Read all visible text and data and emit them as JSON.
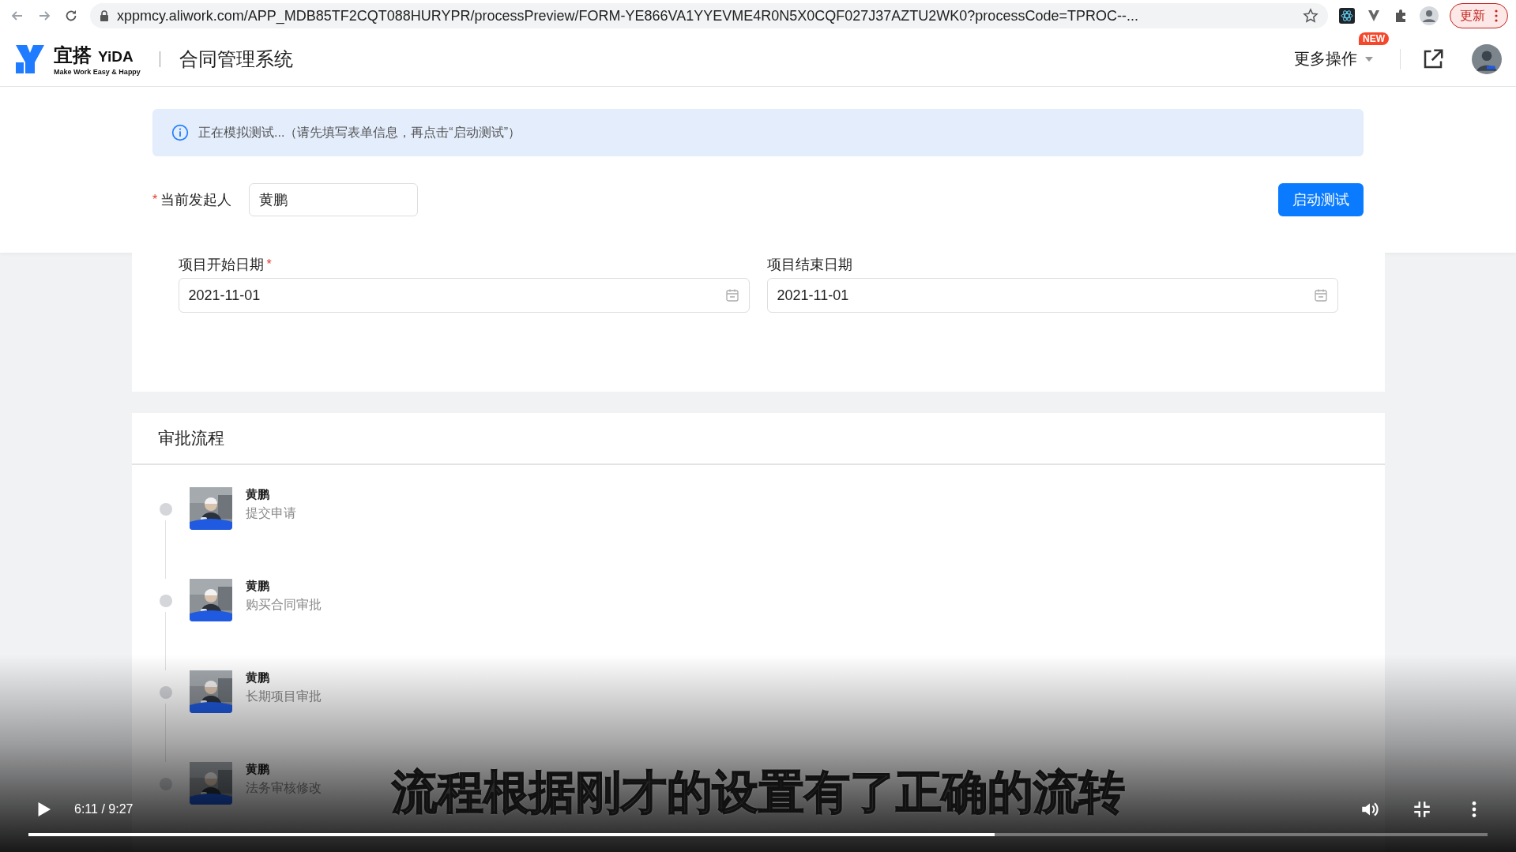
{
  "browser": {
    "url": "xppmcy.aliwork.com/APP_MDB85TF2CQT088HURYPR/processPreview/FORM-YE866VA1YYEVME4R0N5X0CQF027J37AZTU2WK0?processCode=TPROC--...",
    "update_button": "更新"
  },
  "app_header": {
    "logo_text": "宜搭",
    "logo_brand": "YiDA",
    "logo_tagline": "Make Work Easy & Happy",
    "title": "合同管理系统",
    "more_actions": "更多操作",
    "new_badge": "NEW"
  },
  "test_banner": {
    "message": "正在模拟测试...（请先填写表单信息，再点击“启动测试”）"
  },
  "initiator": {
    "required_mark": "*",
    "label": "当前发起人",
    "value": "黄鹏",
    "start_button": "启动测试"
  },
  "date_fields": [
    {
      "label": "项目开始日期",
      "required_mark": "*",
      "value": "2021-11-01"
    },
    {
      "label": "项目结束日期",
      "value": "2021-11-01"
    }
  ],
  "approval": {
    "title": "审批流程",
    "steps": [
      {
        "name": "黄鹏",
        "action": "提交申请"
      },
      {
        "name": "黄鹏",
        "action": "购买合同审批"
      },
      {
        "name": "黄鹏",
        "action": "长期项目审批"
      },
      {
        "name": "黄鹏",
        "action": "法务审核修改"
      }
    ]
  },
  "video": {
    "subtitle": "流程根据刚才的设置有了正确的流转",
    "time": "6:11 / 9:27",
    "progress": {
      "level": 0.662
    }
  }
}
